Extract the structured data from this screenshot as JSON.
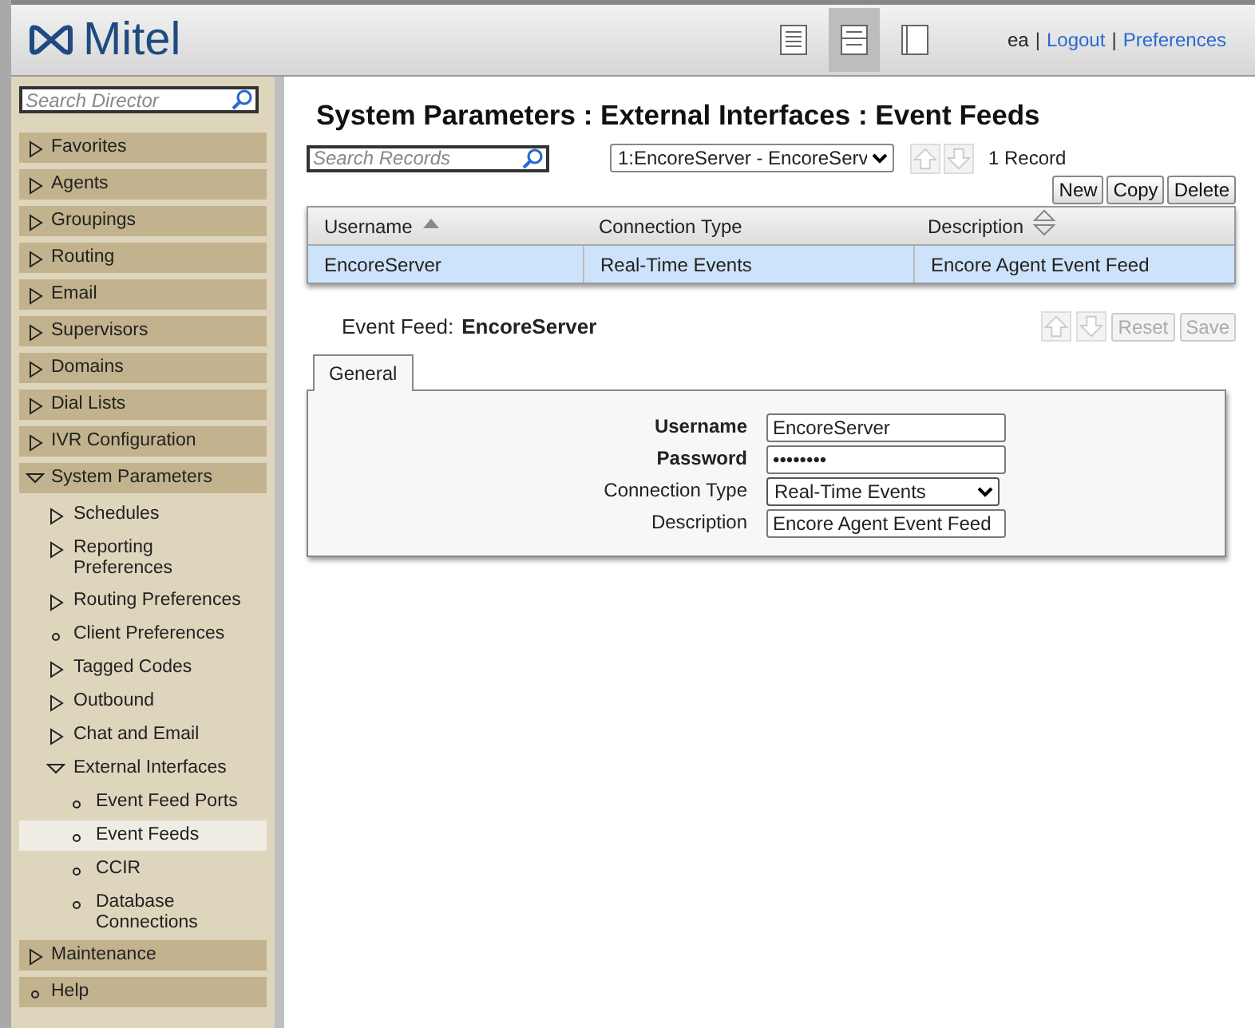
{
  "header": {
    "logo": "Mitel",
    "views": [
      {
        "kind": "list",
        "selected": false
      },
      {
        "kind": "split",
        "selected": true
      },
      {
        "kind": "single",
        "selected": false
      }
    ],
    "user": "ea",
    "separator": "|",
    "links": [
      "Logout",
      "Preferences"
    ]
  },
  "sidebar": {
    "search": {
      "placeholder": "Search Director"
    },
    "items": [
      {
        "label": "Favorites",
        "kind": "folder",
        "expanded": false,
        "selected": false
      },
      {
        "label": "Agents",
        "kind": "folder",
        "expanded": false,
        "selected": false
      },
      {
        "label": "Groupings",
        "kind": "folder",
        "expanded": false,
        "selected": false
      },
      {
        "label": "Routing",
        "kind": "folder",
        "expanded": false,
        "selected": false
      },
      {
        "label": "Email",
        "kind": "folder",
        "expanded": false,
        "selected": false
      },
      {
        "label": "Supervisors",
        "kind": "folder",
        "expanded": false,
        "selected": false
      },
      {
        "label": "Domains",
        "kind": "folder",
        "expanded": false,
        "selected": false
      },
      {
        "label": "Dial Lists",
        "kind": "folder",
        "expanded": false,
        "selected": false
      },
      {
        "label": "IVR Configuration",
        "kind": "folder",
        "expanded": false,
        "selected": false
      },
      {
        "label": "System Parameters",
        "kind": "folder",
        "expanded": true,
        "selected": false,
        "children": [
          {
            "label": "Schedules",
            "kind": "folder",
            "expanded": false,
            "selected": false
          },
          {
            "label": "Reporting Preferences",
            "kind": "folder",
            "expanded": false,
            "selected": false
          },
          {
            "label": "Routing Preferences",
            "kind": "folder",
            "expanded": false,
            "selected": false
          },
          {
            "label": "Client Preferences",
            "kind": "leaf",
            "selected": false
          },
          {
            "label": "Tagged Codes",
            "kind": "folder",
            "expanded": false,
            "selected": false
          },
          {
            "label": "Outbound",
            "kind": "folder",
            "expanded": false,
            "selected": false
          },
          {
            "label": "Chat and Email",
            "kind": "folder",
            "expanded": false,
            "selected": false
          },
          {
            "label": "External Interfaces",
            "kind": "folder",
            "expanded": true,
            "selected": false,
            "children": [
              {
                "label": "Event Feed Ports",
                "kind": "leaf",
                "selected": false
              },
              {
                "label": "Event Feeds",
                "kind": "leaf",
                "selected": true
              },
              {
                "label": "CCIR",
                "kind": "leaf",
                "selected": false
              },
              {
                "label": "Database Connections",
                "kind": "leaf",
                "selected": false
              }
            ]
          }
        ]
      },
      {
        "label": "Maintenance",
        "kind": "folder",
        "expanded": false,
        "selected": false
      },
      {
        "label": "Help",
        "kind": "leaf",
        "selected": false
      }
    ]
  },
  "main": {
    "title": "System Parameters : External Interfaces : Event Feeds",
    "search": {
      "placeholder": "Search Records"
    },
    "record_select": "1:EncoreServer - EncoreServ",
    "record_count": "1 Record",
    "actions": [
      "New",
      "Copy",
      "Delete"
    ],
    "table": {
      "columns": [
        {
          "label": "Username",
          "sorted_ascending": true,
          "sortable": false
        },
        {
          "label": "Connection Type",
          "sorted_ascending": false,
          "sortable": false
        },
        {
          "label": "Description",
          "sorted_ascending": false,
          "sortable": true
        }
      ],
      "rows": [
        {
          "cells": [
            "EncoreServer",
            "Real-Time Events",
            "Encore Agent Event Feed"
          ],
          "selected": true
        }
      ]
    },
    "detail": {
      "label": "Event Feed:",
      "name": "EncoreServer",
      "buttons": [
        "Reset",
        "Save"
      ],
      "tabs": [
        {
          "label": "General",
          "selected": true
        }
      ],
      "fields": [
        {
          "label": "Username",
          "bold": true,
          "kind": "text",
          "value": "EncoreServer"
        },
        {
          "label": "Password",
          "bold": true,
          "kind": "text",
          "value": "••••••••"
        },
        {
          "label": "Connection Type",
          "bold": false,
          "kind": "select",
          "value": "Real-Time Events"
        },
        {
          "label": "Description",
          "bold": false,
          "kind": "text",
          "value": "Encore Agent Event Feed"
        }
      ]
    }
  }
}
